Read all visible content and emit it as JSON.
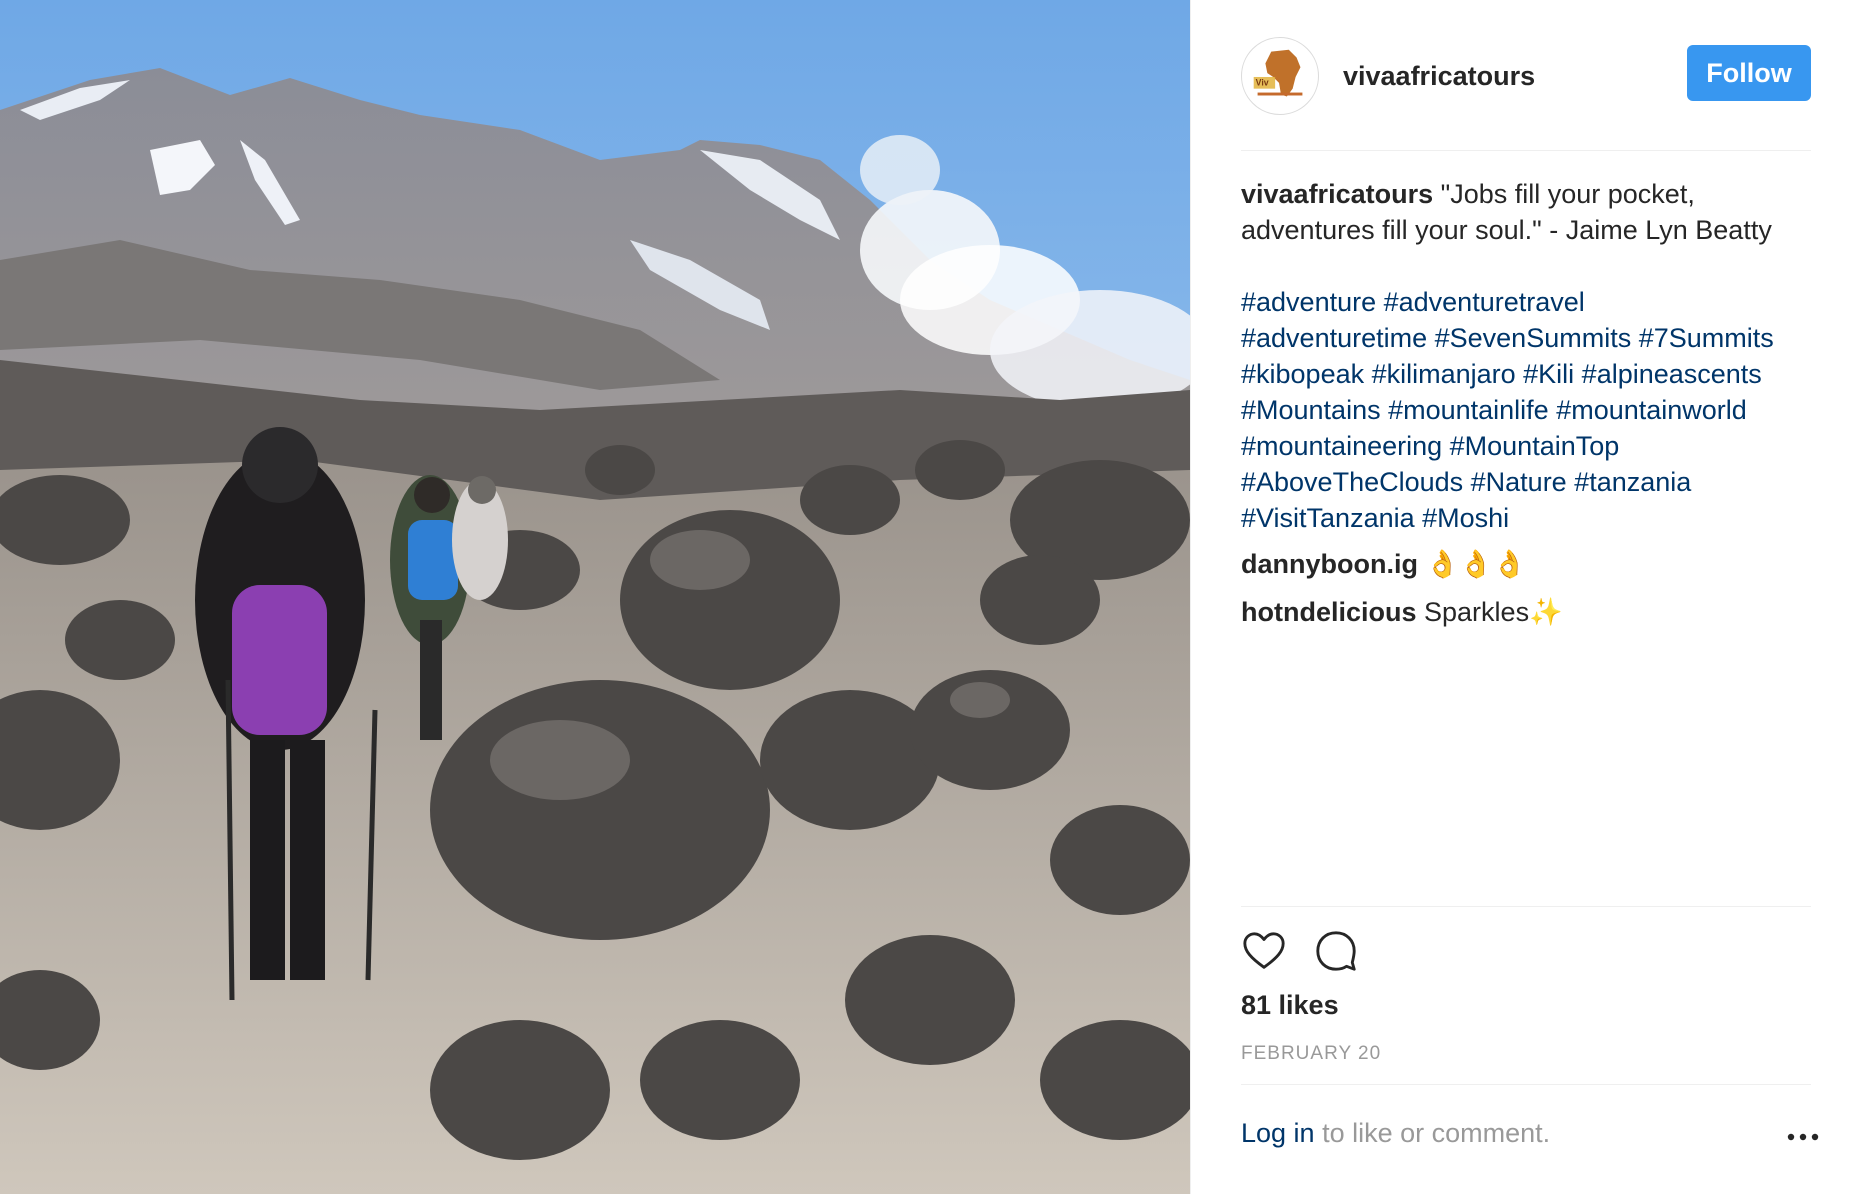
{
  "post": {
    "username": "vivaafricatours",
    "follow_label": "Follow",
    "caption_user": "vivaafricatours",
    "caption_text": "\"Jobs fill your pocket, adventures fill your soul.\" - Jaime Lyn Beatty",
    "hashtags": [
      "#adventure #adventuretravel",
      "#adventuretime #SevenSummits #7Summits",
      "#kibopeak #kilimanjaro #Kili #alpineascents",
      "#Mountains #mountainlife #mountainworld",
      "#mountaineering #MountainTop",
      "#AboveTheClouds #Nature #tanzania",
      "#VisitTanzania #Moshi"
    ],
    "comments": [
      {
        "user": "dannyboon.ig",
        "text": "👌👌👌"
      },
      {
        "user": "hotndelicious",
        "text": "Sparkles✨"
      }
    ],
    "likes": "81 likes",
    "date": "FEBRUARY 20",
    "login_link": "Log in",
    "login_suffix": " to like or comment."
  },
  "colors": {
    "follow_button": "#3897f0",
    "hashtag": "#003569",
    "muted": "#999999",
    "text": "#262626"
  },
  "icons": {
    "like": "heart-icon",
    "comment": "comment-icon",
    "more": "more-options-icon",
    "avatar": "africa-logo-avatar"
  }
}
